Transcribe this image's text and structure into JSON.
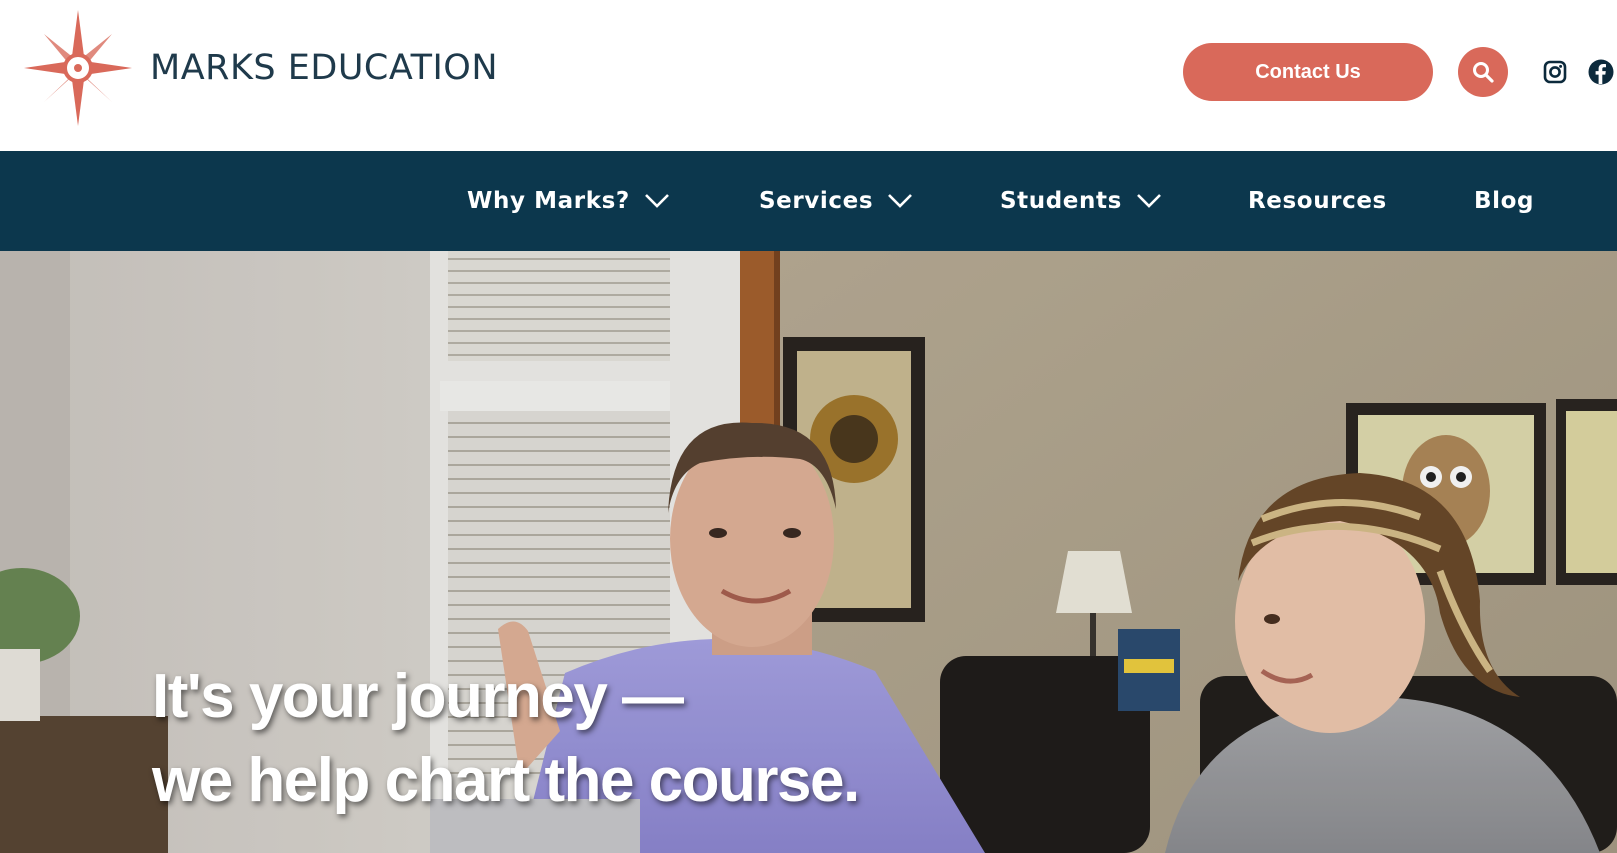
{
  "header": {
    "brand_name": "MARKS EDUCATION",
    "logo_icon": "compass-star-icon",
    "contact_label": "Contact Us",
    "search_icon": "search-icon",
    "social": [
      {
        "name": "Instagram",
        "icon": "instagram-icon"
      },
      {
        "name": "Facebook",
        "icon": "facebook-icon"
      }
    ]
  },
  "nav": {
    "items": [
      {
        "label": "Why Marks?",
        "has_dropdown": true
      },
      {
        "label": "Services",
        "has_dropdown": true
      },
      {
        "label": "Students",
        "has_dropdown": true
      },
      {
        "label": "Resources",
        "has_dropdown": false
      },
      {
        "label": "Blog",
        "has_dropdown": false
      }
    ]
  },
  "hero": {
    "headline_line1": "It's your journey —",
    "headline_line2": "we help chart the course."
  },
  "colors": {
    "brand_navy": "#0c374d",
    "accent_coral": "#d9695a",
    "logo_text": "#1f3a4b",
    "white": "#ffffff"
  }
}
